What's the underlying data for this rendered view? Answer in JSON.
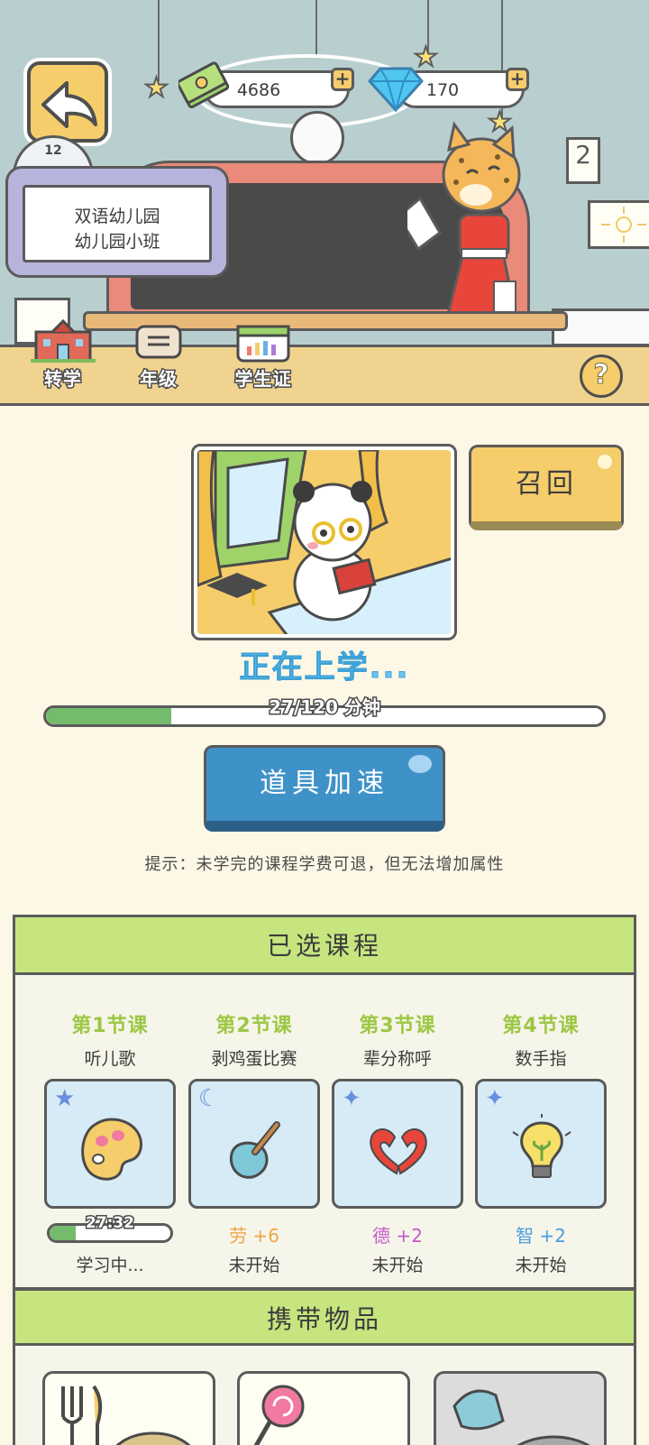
{
  "header": {
    "coins": "4686",
    "gems": "170",
    "level": "12",
    "school": {
      "line1": "双语幼儿园",
      "line2": "幼儿园小班"
    },
    "notepad_number": "2"
  },
  "toolbar": {
    "transfer_label": "转学",
    "grade_label": "年级",
    "student_id_label": "学生证",
    "help_label": "?"
  },
  "study": {
    "recall_label": "召回",
    "status_text": "正在上学...",
    "progress_text": "27/120 分钟",
    "progress_value": 27,
    "progress_total": 120,
    "speedup_label": "道具加速",
    "tip_text": "提示：未学完的课程学费可退，但无法增加属性"
  },
  "courses": {
    "title": "已选课程",
    "list": [
      {
        "num": "第1节课",
        "name": "听儿歌",
        "stat": "",
        "state": "学习中...",
        "timer": "27:32",
        "progress": 0.22
      },
      {
        "num": "第2节课",
        "name": "剥鸡蛋比赛",
        "stat": "劳 +6",
        "state": "未开始"
      },
      {
        "num": "第3节课",
        "name": "辈分称呼",
        "stat": "德 +2",
        "state": "未开始"
      },
      {
        "num": "第4节课",
        "name": "数手指",
        "stat": "智 +2",
        "state": "未开始"
      }
    ]
  },
  "items": {
    "title": "携带物品"
  },
  "colors": {
    "accent_yellow": "#f6cd6b",
    "accent_blue": "#3f92c8",
    "panel_green": "#c6e57f",
    "progress_green": "#74bb6c",
    "labor": "#f0a64a",
    "morality": "#c45ac8",
    "intellect": "#4a9ee0"
  }
}
